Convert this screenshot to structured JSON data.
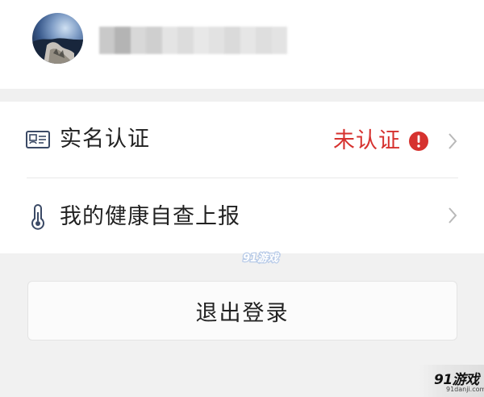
{
  "profile": {
    "avatar_alt": "avatar"
  },
  "settings": {
    "items": [
      {
        "label": "实名认证",
        "icon": "id-card-icon",
        "status": "未认证",
        "status_icon": "exclamation-icon",
        "status_color": "#d6322f"
      },
      {
        "label": "我的健康自查上报",
        "icon": "thermometer-icon"
      }
    ]
  },
  "actions": {
    "logout_label": "退出登录"
  },
  "watermark": {
    "center_text": "91游戏",
    "corner_brand": "91游戏",
    "corner_url": "91danji.com"
  },
  "colors": {
    "status_red": "#d6322f",
    "text_primary": "#222222",
    "page_bg": "#f1f1f1"
  }
}
